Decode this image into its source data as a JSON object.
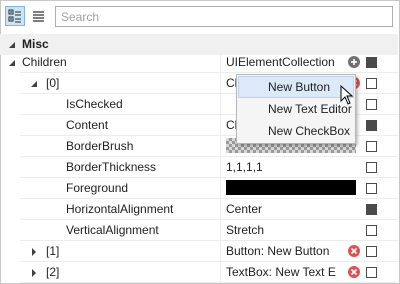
{
  "toolbar": {
    "categorized_icon": "categorized-view-icon",
    "alphabetical_icon": "alphabetical-list-icon",
    "search_placeholder": "Search"
  },
  "category": {
    "label": "Misc"
  },
  "rows": {
    "children": {
      "name": "Children",
      "value": "UIElementCollection"
    },
    "item0": {
      "name": "[0]",
      "value": "Cl"
    },
    "is_checked": {
      "name": "IsChecked",
      "value": ""
    },
    "content": {
      "name": "Content",
      "value": "Cl"
    },
    "border_brush": {
      "name": "BorderBrush"
    },
    "border_thickness": {
      "name": "BorderThickness",
      "value": "1,1,1,1"
    },
    "foreground": {
      "name": "Foreground",
      "color": "#000000"
    },
    "horizontal_alignment": {
      "name": "HorizontalAlignment",
      "value": "Center"
    },
    "vertical_alignment": {
      "name": "VerticalAlignment",
      "value": "Stretch"
    },
    "item1": {
      "name": "[1]",
      "value": "Button: New Button"
    },
    "item2": {
      "name": "[2]",
      "value": "TextBox: New Text E"
    }
  },
  "menu": {
    "new_button": "New Button",
    "new_text_editor": "New Text Editor",
    "new_checkbox": "New CheckBox"
  },
  "colors": {
    "remove_icon": "#e05252",
    "add_icon": "#707070",
    "selection": "#dbe9f8",
    "category_bg": "#f0f0f0"
  }
}
